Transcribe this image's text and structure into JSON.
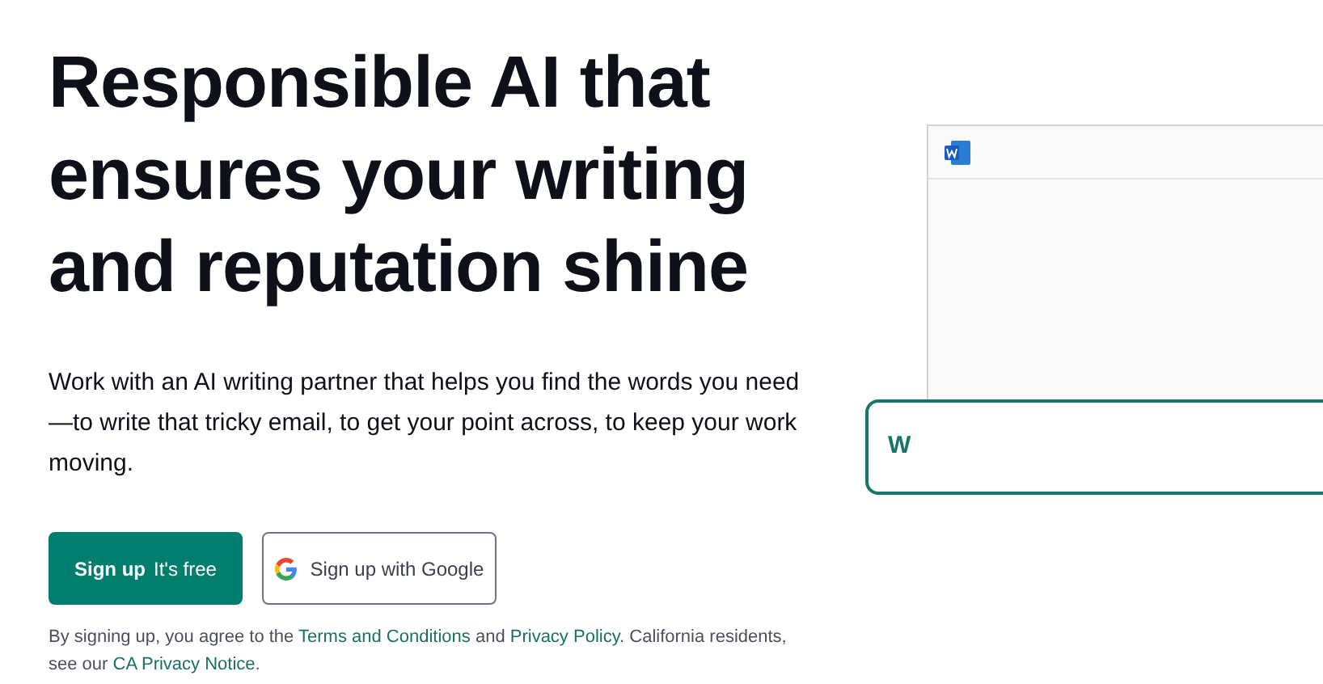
{
  "headline": "Responsible AI that ensures your writing and reputation shine",
  "intro": "Work with an AI writing partner that helps you find the words you need—to write that tricky email, to get your point across, to keep your work moving.",
  "signup_button": {
    "label": "Sign up",
    "note": "It's free"
  },
  "google_button": {
    "label": "Sign up with Google"
  },
  "legal": [
    {
      "kind": "text",
      "text": "By signing up, you agree to the "
    },
    {
      "kind": "link",
      "text": "Terms and Conditions"
    },
    {
      "kind": "text",
      "text": " and "
    },
    {
      "kind": "link",
      "text": "Privacy Policy"
    },
    {
      "kind": "text",
      "text": ". California residents, see our "
    },
    {
      "kind": "link",
      "text": "CA Privacy Notice"
    },
    {
      "kind": "text",
      "text": "."
    }
  ],
  "preview": {
    "typed_text": "W"
  }
}
